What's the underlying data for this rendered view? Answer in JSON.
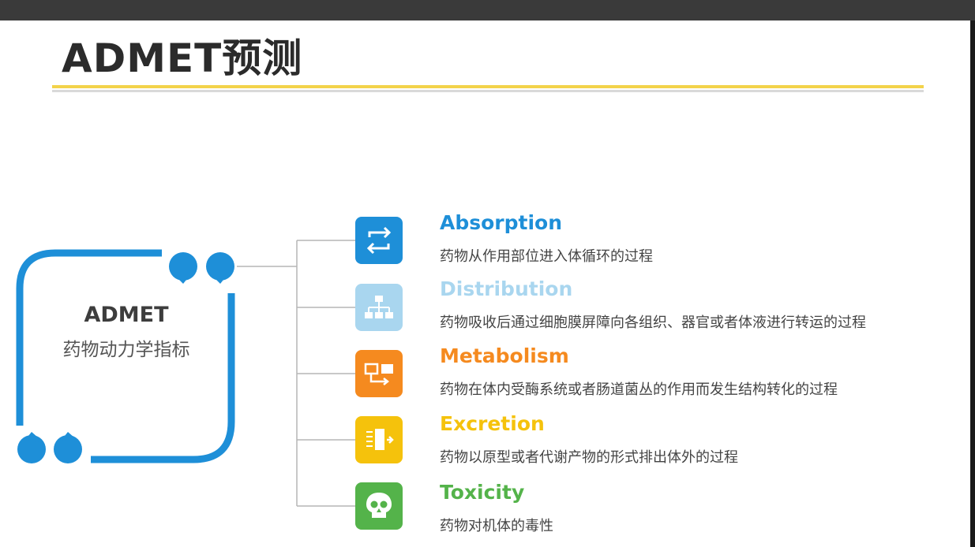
{
  "title": "ADMET预测",
  "center": {
    "title": "ADMET",
    "subtitle": "药物动力学指标"
  },
  "colors": {
    "frame": "#1e8fd8",
    "absorption": "#1e8fd8",
    "distribution": "#a9d6ef",
    "metabolism": "#f58a1f",
    "excretion": "#f5c20c",
    "toxicity": "#54b34a"
  },
  "items": [
    {
      "name": "Absorption",
      "desc": "药物从作用部位进入体循环的过程",
      "icon": "swap-arrows-icon"
    },
    {
      "name": "Distribution",
      "desc": "药物吸收后通过细胞膜屏障向各组织、器官或者体液进行转运的过程",
      "icon": "hierarchy-icon"
    },
    {
      "name": "Metabolism",
      "desc": "药物在体内受酶系统或者肠道菌丛的作用而发生结构转化的过程",
      "icon": "flow-icon"
    },
    {
      "name": "Excretion",
      "desc": "药物以原型或者代谢产物的形式排出体外的过程",
      "icon": "export-icon"
    },
    {
      "name": "Toxicity",
      "desc": "药物对机体的毒性",
      "icon": "skull-icon"
    }
  ]
}
